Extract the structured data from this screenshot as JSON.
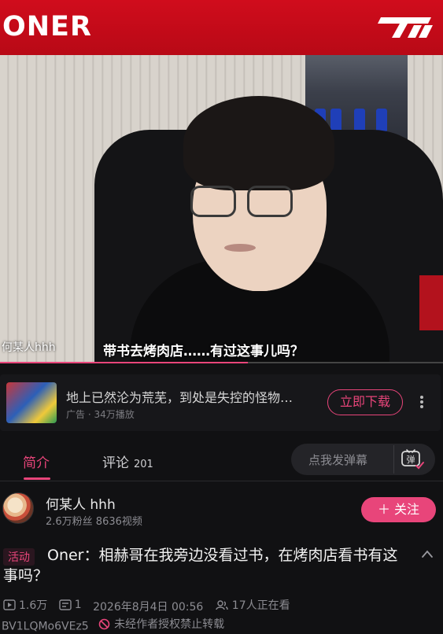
{
  "video": {
    "overlay_logo": "ONER",
    "team_logo_icon": "t1-logo",
    "uploader_watermark": "何某人hhh",
    "subtitle": "带书去烤肉店……有过这事儿吗？",
    "progress_percent": 56
  },
  "ad": {
    "title": "地上已然沦为荒芜，到处是失控的怪物…",
    "label": "广告",
    "views": "34万播放",
    "download_label": "立即下载",
    "more_icon": "more-vertical-icon"
  },
  "tabs": {
    "intro_label": "简介",
    "comments_label": "评论",
    "comments_count": "201",
    "danmaku_placeholder": "点我发弹幕",
    "danmaku_icon": "danmaku-toggle-icon"
  },
  "uploader": {
    "name": "何某人 hhh",
    "stats": "2.6万粉丝  8636视频",
    "follow_label": "＋ 关注"
  },
  "video_info": {
    "activity_tag": "活动",
    "title": "Oner：相赫哥在我旁边没看过书，在烤肉店看书有这事吗？",
    "plays": "1.6万",
    "danmaku_count": "1",
    "date": "2026年8月4日 00:56",
    "watching": "17人正在看",
    "bvid": "BV1LQMo6VEz5",
    "copyright": "未经作者授权禁止转载"
  },
  "colors": {
    "accent": "#e8457a",
    "background": "#111113",
    "banner_red": "#c90b1a"
  }
}
